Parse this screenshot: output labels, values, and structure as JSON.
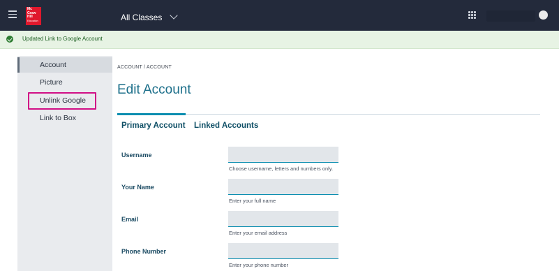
{
  "header": {
    "logo_lines": [
      "Mc",
      "Graw",
      "Hill",
      "Education"
    ],
    "class_selector": "All Classes"
  },
  "alert": {
    "message": "Updated Link to Google Account",
    "color": "#e7f3e4"
  },
  "sidebar": {
    "items": [
      {
        "label": "Account",
        "active": true
      },
      {
        "label": "Picture",
        "active": false
      },
      {
        "label": "Unlink Google",
        "active": false,
        "highlighted": true
      },
      {
        "label": "Link to Box",
        "active": false
      }
    ]
  },
  "main": {
    "breadcrumb": "ACCOUNT / ACCOUNT",
    "title": "Edit Account",
    "tabs": [
      {
        "label": "Primary Account",
        "selected": true
      },
      {
        "label": "Linked Accounts",
        "selected": false
      }
    ],
    "fields": [
      {
        "label": "Username",
        "value": "",
        "hint": "Choose username, letters and numbers only."
      },
      {
        "label": "Your Name",
        "value": "",
        "hint": "Enter your full name"
      },
      {
        "label": "Email",
        "value": "",
        "hint": "Enter your email address"
      },
      {
        "label": "Phone Number",
        "value": "",
        "hint": "Enter your phone number"
      }
    ]
  },
  "colors": {
    "topbar": "#232a3b",
    "accent": "#0c8eb0",
    "title": "#1c6f8a",
    "highlight": "#d10f86",
    "logo": "#e0182d"
  }
}
